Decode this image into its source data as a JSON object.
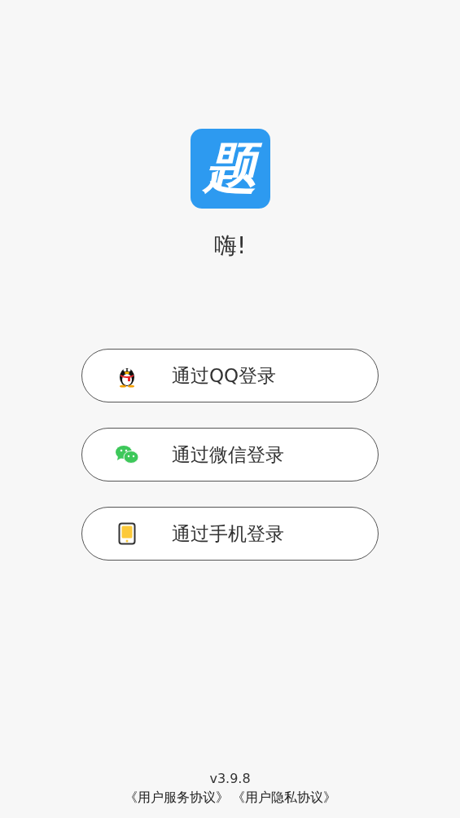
{
  "logo": {
    "text": "题"
  },
  "greeting": "嗨!",
  "login_buttons": [
    {
      "kind": "qq",
      "label": "通过QQ登录"
    },
    {
      "kind": "wechat",
      "label": "通过微信登录"
    },
    {
      "kind": "phone",
      "label": "通过手机登录"
    }
  ],
  "footer": {
    "version": "v3.9.8",
    "links": [
      "《用户服务协议》",
      "《用户隐私协议》"
    ]
  }
}
